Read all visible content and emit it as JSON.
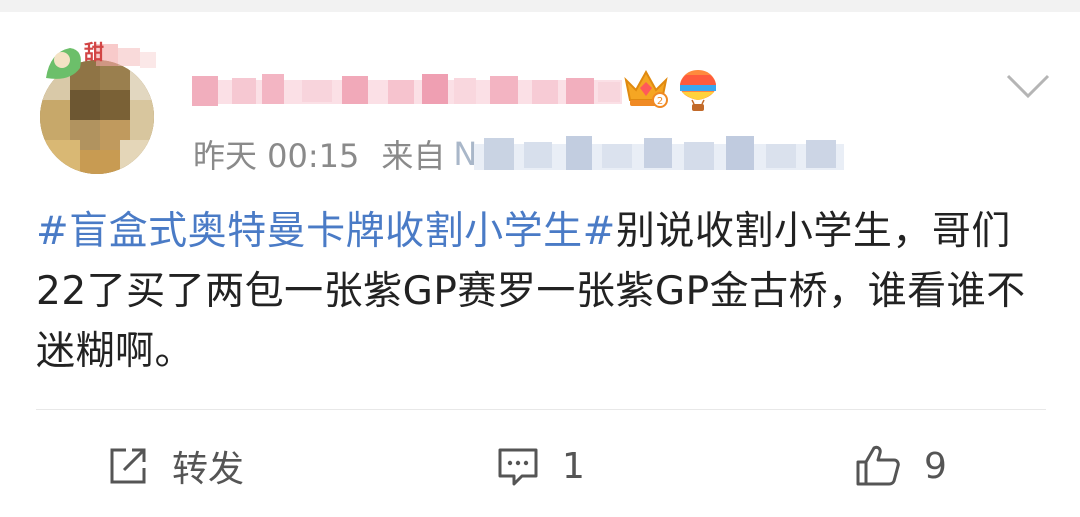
{
  "post": {
    "meta": {
      "time": "昨天 00:15",
      "from_label": "来自",
      "source_visible_prefix": "N"
    },
    "content": {
      "topic": "#盲盒式奥特曼卡牌收割小学生#",
      "body": "别说收割小学生，哥们22了买了两包一张紫GP赛罗一张紫GP金古桥，谁看谁不迷糊啊。"
    },
    "avatar_badge_text": "甜",
    "actions": {
      "repost_label": "转发",
      "comment_count": "1",
      "like_count": "9"
    }
  },
  "icons": {
    "crown": "vip-crown-icon",
    "balloon": "hot-air-balloon-icon",
    "chevron": "chevron-down-icon",
    "repost": "share-icon",
    "comment": "comment-icon",
    "like": "thumbs-up-icon"
  },
  "colors": {
    "topic": "#4a7bc6",
    "text": "#222222",
    "meta": "#8a8a8a"
  }
}
